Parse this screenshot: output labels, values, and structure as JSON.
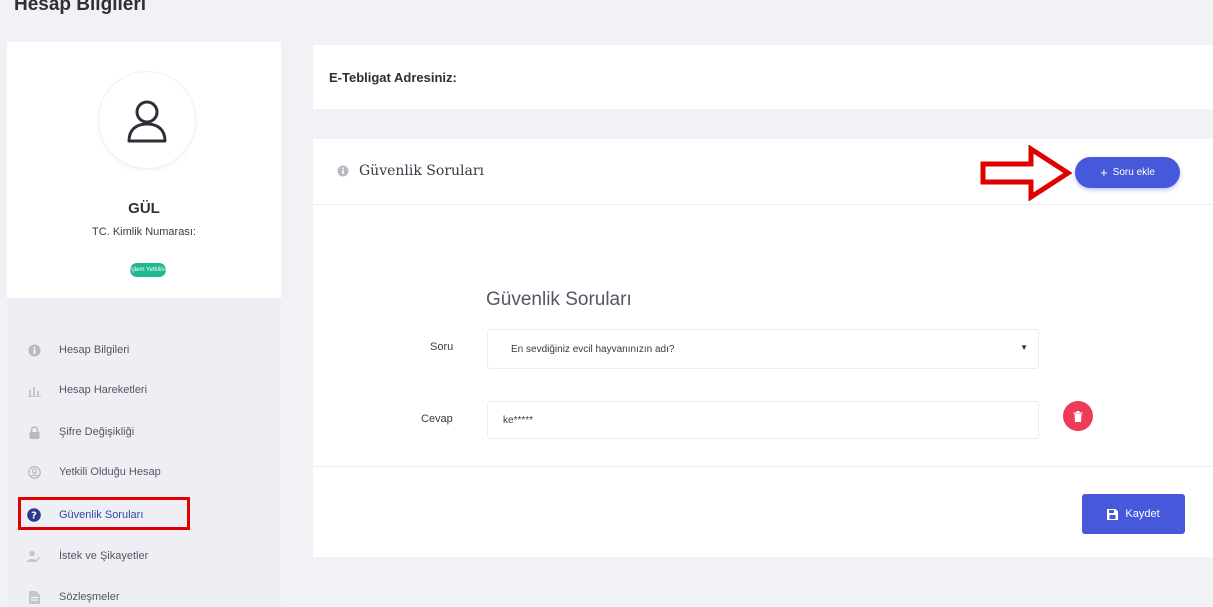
{
  "page": {
    "title": "Hesap Bilgileri"
  },
  "profile": {
    "name": "GÜL",
    "tc_label": "TC. Kimlik Numarası:",
    "status_badge": "İşlem Yetkilisi"
  },
  "sidebar": {
    "items": [
      {
        "label": "Hesap Bilgileri",
        "icon": "info-icon"
      },
      {
        "label": "Hesap Hareketleri",
        "icon": "bar-chart-icon"
      },
      {
        "label": "Şifre Değişikliği",
        "icon": "lock-icon"
      },
      {
        "label": "Yetkili Olduğu Hesap",
        "icon": "user-circle-icon"
      },
      {
        "label": "Güvenlik Soruları",
        "icon": "question-circle-icon",
        "active": true
      },
      {
        "label": "İstek ve Şikayetler",
        "icon": "user-edit-icon"
      },
      {
        "label": "Sözleşmeler",
        "icon": "document-icon"
      }
    ]
  },
  "etebligat": {
    "title": "E-Tebligat Adresiniz:"
  },
  "security": {
    "header_title": "Güvenlik Soruları",
    "add_button": "Soru ekle",
    "form_title": "Güvenlik Soruları",
    "question_label": "Soru",
    "question_value": "En sevdiğiniz evcil hayvanınızın adı?",
    "answer_label": "Cevap",
    "answer_value": "ke*****",
    "save_button": "Kaydet"
  },
  "colors": {
    "accent": "#4759db",
    "badge": "#1fb88f",
    "danger": "#ee3b5a",
    "annotation": "#e00000"
  }
}
